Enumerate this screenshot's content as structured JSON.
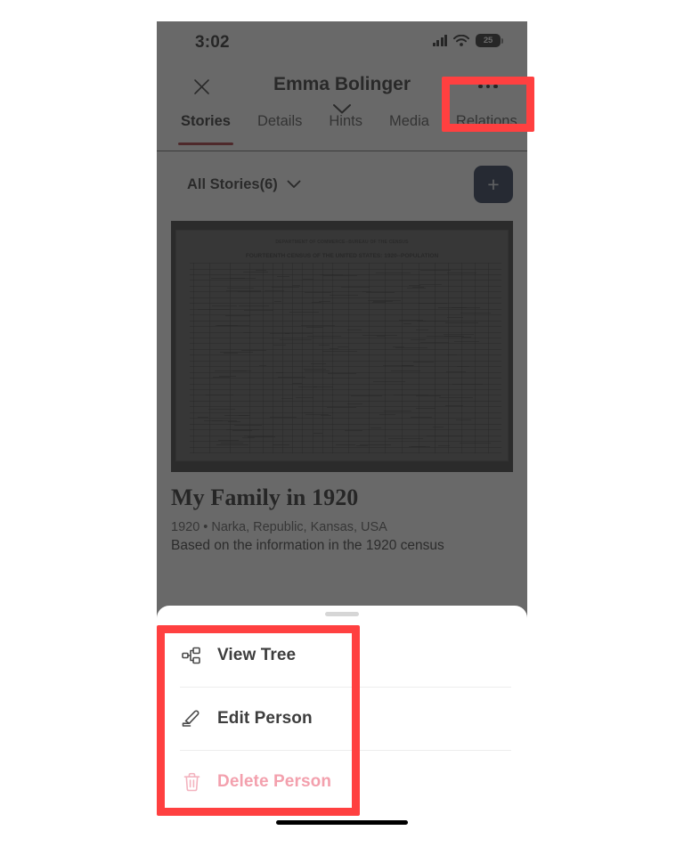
{
  "status_bar": {
    "time": "3:02",
    "battery_level": "25",
    "signal_icon": "cellular-signal-icon",
    "wifi_icon": "wifi-icon",
    "battery_icon": "battery-icon"
  },
  "nav_bar": {
    "close_icon": "close-icon",
    "title": "Emma Bolinger",
    "more_icon": "more-options-icon",
    "expand_icon": "chevron-down-icon"
  },
  "tabs": [
    {
      "label": "Stories",
      "active": true
    },
    {
      "label": "Details",
      "active": false
    },
    {
      "label": "Hints",
      "active": false
    },
    {
      "label": "Media",
      "active": false
    },
    {
      "label": "Relations",
      "active": false
    }
  ],
  "tab_accent_color": "#9e1b23",
  "filter_bar": {
    "filter_label": "All Stories(6)",
    "filter_chevron_icon": "chevron-down-icon",
    "add_label": "+",
    "add_button_color": "#0f1f3d"
  },
  "story": {
    "image_alt": "1920 United States census record page",
    "document_header": "DEPARTMENT OF COMMERCE--BUREAU OF THE CENSUS",
    "document_subheader": "FOURTEENTH CENSUS OF THE UNITED STATES: 1920--POPULATION",
    "title": "My Family in 1920",
    "meta": "1920 • Narka, Republic, Kansas, USA",
    "description": "Based on the information in the 1920 census"
  },
  "action_sheet": {
    "grabber": "drag-handle",
    "items": [
      {
        "label": "View Tree",
        "icon": "tree-icon",
        "danger": false
      },
      {
        "label": "Edit Person",
        "icon": "pencil-icon",
        "danger": false
      },
      {
        "label": "Delete Person",
        "icon": "trash-icon",
        "danger": true
      }
    ],
    "danger_color": "#f3a0ad"
  },
  "annotations": {
    "highlight_color": "#ff4040",
    "boxes": [
      {
        "name": "more-options-highlight"
      },
      {
        "name": "action-sheet-highlight"
      }
    ]
  }
}
